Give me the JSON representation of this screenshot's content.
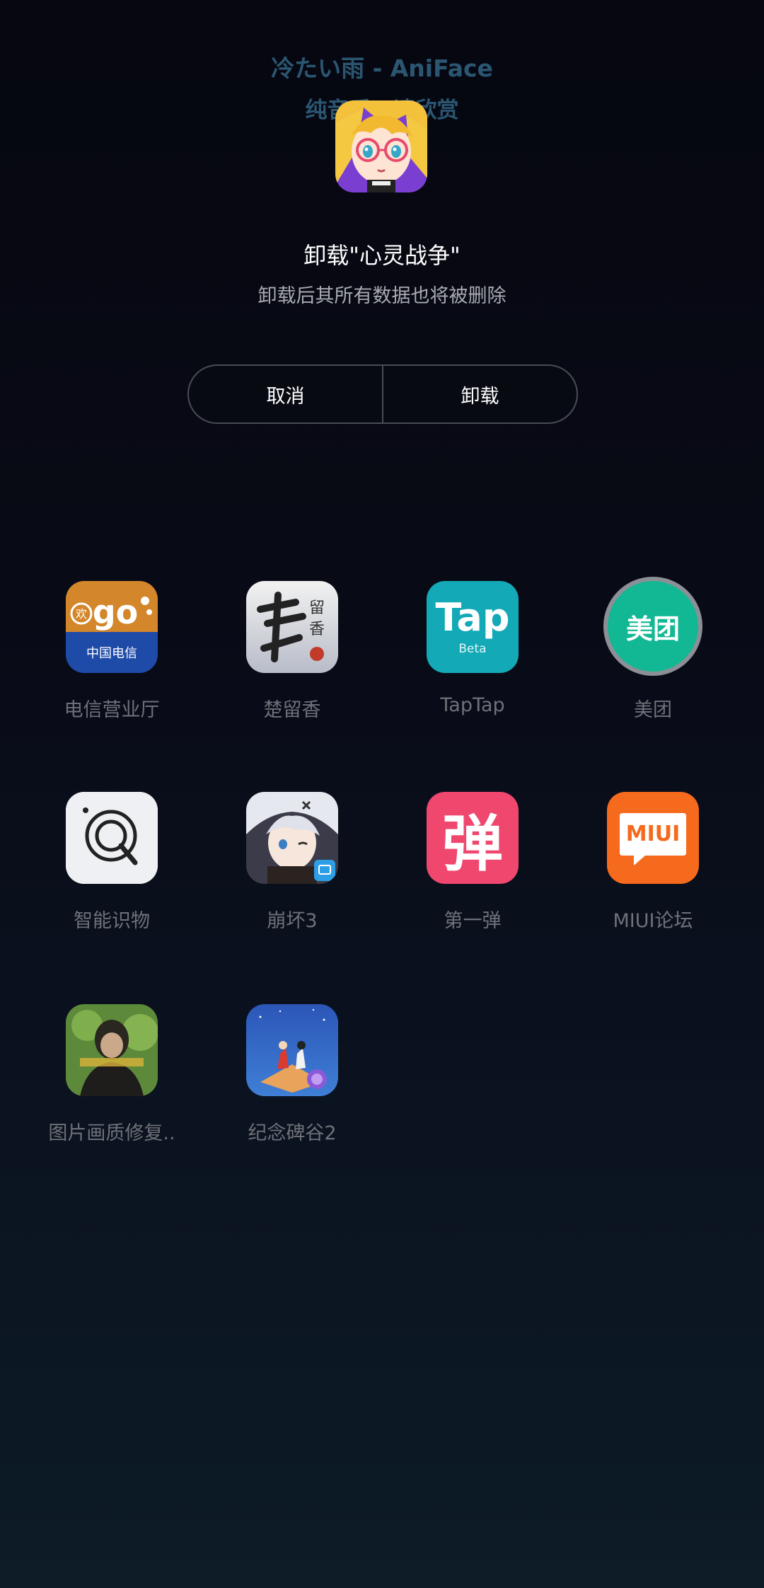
{
  "music_widget": {
    "title": "冷たい雨 - AniFace",
    "subtitle": "纯音乐，请欣赏"
  },
  "uninstall_dialog": {
    "app_icon": "anime-girl-glasses-icon",
    "title": "卸载\"心灵战争\"",
    "message": "卸载后其所有数据也将被删除",
    "cancel_label": "取消",
    "confirm_label": "卸载"
  },
  "apps": [
    {
      "label": "电信营业厅",
      "icon": "telecom-go-icon"
    },
    {
      "label": "楚留香",
      "icon": "chuliuxiang-icon"
    },
    {
      "label": "TapTap",
      "icon": "taptap-icon",
      "icon_text": "Tap",
      "icon_subtext": "Beta"
    },
    {
      "label": "美团",
      "icon": "meituan-icon",
      "icon_text": "美团"
    },
    {
      "label": "智能识物",
      "icon": "magnifier-icon"
    },
    {
      "label": "崩坏3",
      "icon": "honkai-icon"
    },
    {
      "label": "第一弹",
      "icon": "diyidan-icon",
      "icon_text": "弹"
    },
    {
      "label": "MIUI论坛",
      "icon": "miui-forum-icon",
      "icon_text": "MIUI"
    },
    {
      "label": "图片画质修复..",
      "icon": "photo-restore-icon"
    },
    {
      "label": "纪念碑谷2",
      "icon": "monument-valley-icon"
    }
  ]
}
